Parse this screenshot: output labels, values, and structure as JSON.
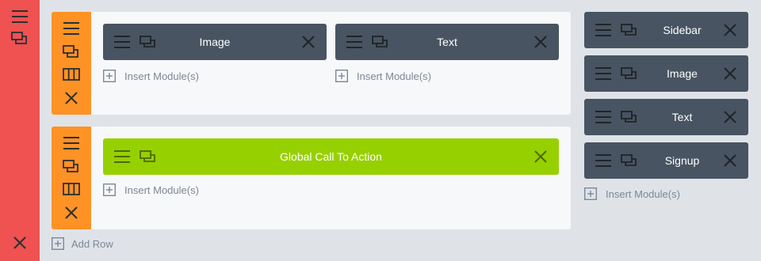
{
  "section": {
    "icons": [
      "menu-lines-icon",
      "duplicate-icon",
      "close-icon"
    ]
  },
  "rows": [
    {
      "control_icons": [
        "menu-lines-icon",
        "duplicate-icon",
        "columns-icon",
        "close-icon"
      ],
      "columns": [
        {
          "module_label": "Image",
          "insert_label": "Insert Module(s)"
        },
        {
          "module_label": "Text",
          "insert_label": "Insert Module(s)"
        }
      ]
    },
    {
      "control_icons": [
        "menu-lines-icon",
        "duplicate-icon",
        "columns-icon",
        "close-icon"
      ],
      "columns": [
        {
          "module_label": "Global Call To Action",
          "insert_label": "Insert Module(s)",
          "global": true
        }
      ]
    }
  ],
  "add_row_label": "Add Row",
  "sidebar": {
    "modules": [
      {
        "label": "Sidebar"
      },
      {
        "label": "Image"
      },
      {
        "label": "Text"
      },
      {
        "label": "Signup"
      }
    ],
    "insert_label": "Insert Module(s)"
  },
  "colors": {
    "section": "#f05151",
    "row_control": "#ff9224",
    "module": "#485461",
    "global_module": "#97d000",
    "background": "#dfe3e8",
    "row_background": "#f7f8f9",
    "muted_text": "#7b8896"
  }
}
